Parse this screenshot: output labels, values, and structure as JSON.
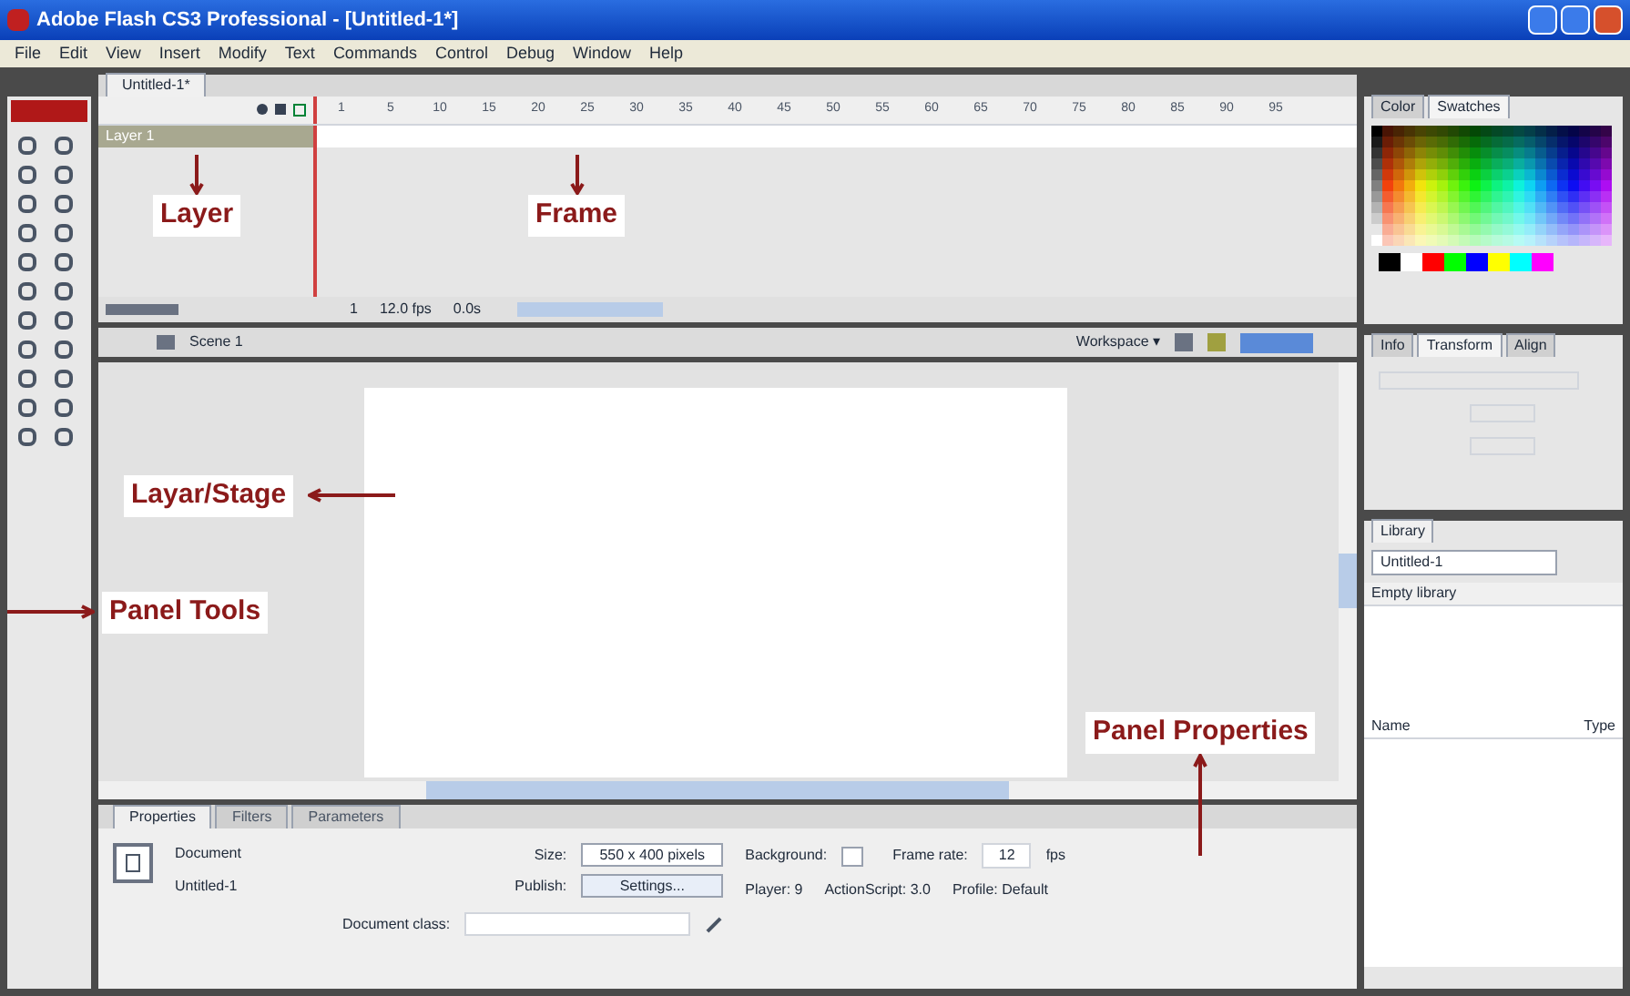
{
  "window": {
    "title": "Adobe Flash CS3 Professional - [Untitled-1*]"
  },
  "menu": [
    "File",
    "Edit",
    "View",
    "Insert",
    "Modify",
    "Text",
    "Commands",
    "Control",
    "Debug",
    "Window",
    "Help"
  ],
  "document_tab": "Untitled-1*",
  "timeline": {
    "ruler": [
      "1",
      "5",
      "10",
      "15",
      "20",
      "25",
      "30",
      "35",
      "40",
      "45",
      "50",
      "55",
      "60",
      "65",
      "70",
      "75",
      "80",
      "85",
      "90",
      "95"
    ],
    "layer": "Layer 1",
    "status": [
      "1",
      "12.0 fps",
      "0.0s"
    ]
  },
  "edit_bar": {
    "scene": "Scene 1",
    "workspace": "Workspace ▾"
  },
  "annotations": [
    {
      "text": "Layer",
      "kind": "down"
    },
    {
      "text": "Frame",
      "kind": "down"
    },
    {
      "text": "Layar/Stage",
      "kind": "left"
    },
    {
      "text": "Panel Tools",
      "kind": "right"
    },
    {
      "text": "Panel Properties",
      "kind": "up"
    }
  ],
  "properties": {
    "tabs": [
      {
        "label": "Properties",
        "selected": true
      },
      {
        "label": "Filters",
        "selected": false
      },
      {
        "label": "Parameters",
        "selected": false
      }
    ],
    "doc_label": "Document",
    "doc_name": "Untitled-1",
    "size_label": "Size:",
    "size": "550 x 400 pixels",
    "publish_label": "Publish:",
    "settings": "Settings...",
    "background_label": "Background:",
    "frame_rate_label": "Frame rate:",
    "frame_rate": "12",
    "fps": "fps",
    "player": "Player: 9",
    "actionscript": "ActionScript: 3.0",
    "profile": "Profile: Default",
    "doc_class_label": "Document class:"
  },
  "color_panel": {
    "tabs": [
      {
        "label": "Color",
        "selected": false
      },
      {
        "label": "Swatches",
        "selected": true
      }
    ]
  },
  "transform_panel": {
    "tabs": [
      {
        "label": "Info",
        "selected": false
      },
      {
        "label": "Transform",
        "selected": true
      },
      {
        "label": "Align",
        "selected": false
      }
    ]
  },
  "library_panel": {
    "tab": "Library",
    "document": "Untitled-1",
    "empty": "Empty library",
    "columns": [
      "Name",
      "Type"
    ]
  }
}
